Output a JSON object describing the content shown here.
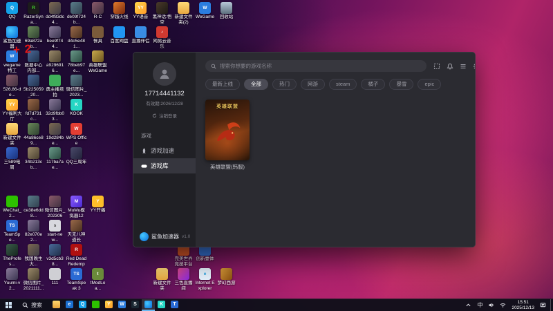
{
  "desktop": {
    "annotation": "+ 2",
    "icons": [
      {
        "label": "QQ",
        "col": 1,
        "row": 1,
        "bg": "#14a0e8",
        "glyph": "Q"
      },
      {
        "label": "RazerSyna...",
        "col": 2,
        "row": 1,
        "bg": "#1c1c1c",
        "fg": "#44d62c",
        "glyph": "R"
      },
      {
        "label": "dd4f83dc4...",
        "col": 3,
        "row": 1,
        "bg": "linear-gradient(135deg,#7d6a52,#3e3a45)"
      },
      {
        "label": "de09f724b...",
        "col": 4,
        "row": 1,
        "bg": "linear-gradient(135deg,#5a7d8a,#31404f)"
      },
      {
        "label": "R-C",
        "col": 5,
        "row": 1,
        "bg": "linear-gradient(135deg,#8a5a6a,#403040)"
      },
      {
        "label": "穿越火线",
        "col": 6,
        "row": 1,
        "bg": "linear-gradient(135deg,#e07a2a,#7a2a10)"
      },
      {
        "label": "YY语音",
        "col": 7,
        "row": 1,
        "bg": "linear-gradient(135deg,#ffd84a,#ff9a2a)",
        "glyph": "YY"
      },
      {
        "label": "黑神话:悟空",
        "col": 8,
        "row": 1,
        "bg": "linear-gradient(135deg,#4a3a2a,#1c1814)"
      },
      {
        "label": "新建文件夹(2)",
        "col": 9,
        "row": 1,
        "bg": "linear-gradient(180deg,#ffd976,#e8a841)"
      },
      {
        "label": "WeGame",
        "col": 10,
        "row": 1,
        "bg": "#2b7de0",
        "glyph": "W"
      },
      {
        "label": "回收站",
        "col": 11,
        "row": 1,
        "bg": "linear-gradient(180deg,#b8c8d8,#5d707e)"
      },
      {
        "label": "鲨鱼加速器",
        "col": 1,
        "row": 2,
        "bg": "radial-gradient(circle at 35% 35%,#45c8ff,#0a6bd8)"
      },
      {
        "label": "69a872ab...",
        "col": 2,
        "row": 2,
        "bg": "linear-gradient(135deg,#6a8a5a,#2f4030)"
      },
      {
        "label": "bee9f744...",
        "col": 3,
        "row": 2,
        "bg": "linear-gradient(135deg,#8a7a9a,#3a3550)"
      },
      {
        "label": "d4c5e481...",
        "col": 4,
        "row": 2,
        "bg": "linear-gradient(135deg,#9a6a4a,#4a3020)"
      },
      {
        "label": "餐具",
        "col": 5,
        "row": 2,
        "bg": "#7a5a3a"
      },
      {
        "label": "百度网盘",
        "col": 6,
        "row": 2,
        "bg": "#2196f3"
      },
      {
        "label": "直播伴侣",
        "col": 7,
        "row": 2,
        "bg": "#3a8ee6"
      },
      {
        "label": "网易云音乐",
        "col": 8,
        "row": 2,
        "bg": "#d33a31",
        "glyph": "♪"
      },
      {
        "label": "wegame特工",
        "col": 1,
        "row": 3,
        "bg": "#2b7de0",
        "glyph": "W"
      },
      {
        "label": "数据中心内部...",
        "col": 2,
        "row": 3,
        "bg": "linear-gradient(135deg,#4a6a9a,#20304a)"
      },
      {
        "label": "a9296916...",
        "col": 3,
        "row": 3,
        "bg": "linear-gradient(135deg,#9a8a6a,#4a4030)"
      },
      {
        "label": "78beb97e...",
        "col": 4,
        "row": 3,
        "bg": "linear-gradient(135deg,#6a9a8a,#2a4a40)"
      },
      {
        "label": "英雄联盟WeGame",
        "col": 5,
        "row": 3,
        "bg": "linear-gradient(135deg,#c8a84b,#6b5420)"
      },
      {
        "label": "526.86-de...",
        "col": 1,
        "row": 4,
        "bg": "linear-gradient(135deg,#8a5a6a,#403040)"
      },
      {
        "label": "5b225059_20...",
        "col": 2,
        "row": 4,
        "bg": "linear-gradient(135deg,#4a6a9a,#20304a)"
      },
      {
        "label": "典主播竞拍",
        "col": 3,
        "row": 4,
        "bg": "#3fae5a"
      },
      {
        "label": "微信图片_2023...",
        "col": 4,
        "row": 4,
        "bg": "linear-gradient(135deg,#5a7d8a,#31404f)"
      },
      {
        "label": "YY福利大厅",
        "col": 1,
        "row": 5,
        "bg": "linear-gradient(135deg,#ffd84a,#ff9a2a)",
        "glyph": "YY"
      },
      {
        "label": "fd7d731c...",
        "col": 2,
        "row": 5,
        "bg": "linear-gradient(135deg,#9a6a4a,#4a3020)"
      },
      {
        "label": "32d9fbb03...",
        "col": 3,
        "row": 5,
        "bg": "linear-gradient(135deg,#8a7a9a,#3a3550)"
      },
      {
        "label": "KOOK",
        "col": 4,
        "row": 5,
        "bg": "#26d6c4",
        "glyph": "K"
      },
      {
        "label": "新建文件夹",
        "col": 1,
        "row": 6,
        "bg": "linear-gradient(180deg,#ffd976,#e8a841)"
      },
      {
        "label": "44a86ce89...",
        "col": 2,
        "row": 6,
        "bg": "linear-gradient(135deg,#6a8a5a,#2f4030)"
      },
      {
        "label": "19d284be...",
        "col": 3,
        "row": 6,
        "bg": "linear-gradient(135deg,#7d6a52,#3e3a45)"
      },
      {
        "label": "WPS Office",
        "col": 4,
        "row": 6,
        "bg": "#e33e33",
        "glyph": "W"
      },
      {
        "label": "三589电周",
        "col": 1,
        "row": 7,
        "bg": "linear-gradient(135deg,#3a6ad0,#18307a)"
      },
      {
        "label": "34b213cb...",
        "col": 2,
        "row": 7,
        "bg": "linear-gradient(135deg,#9a8a6a,#4a4030)"
      },
      {
        "label": "117ba7ae...",
        "col": 3,
        "row": 7,
        "bg": "linear-gradient(135deg,#6a9a8a,#2a4a40)"
      },
      {
        "label": "QQ三周年",
        "col": 4,
        "row": 7,
        "bg": "linear-gradient(135deg,#4a4a6a,#22223a)"
      },
      {
        "label": "WeChat_2...",
        "col": 1,
        "row": 9,
        "bg": "#2dc100"
      },
      {
        "label": "ce38e6dd8...",
        "col": 2,
        "row": 9,
        "bg": "linear-gradient(135deg,#5a7d8a,#31404f)"
      },
      {
        "label": "微信图片_2023060...",
        "col": 3,
        "row": 9,
        "bg": "linear-gradient(135deg,#8a5a6a,#403040)"
      },
      {
        "label": "MuMu模拟器12",
        "col": 4,
        "row": 9,
        "bg": "linear-gradient(135deg,#8a5aff,#4a2ad0)",
        "glyph": "M"
      },
      {
        "label": "YY开播",
        "col": 5,
        "row": 9,
        "bg": "#ffbf2a",
        "glyph": "Y"
      },
      {
        "label": "TeamSpe...",
        "col": 1,
        "row": 10,
        "bg": "#2a6ad4",
        "glyph": "TS"
      },
      {
        "label": "82e070e2...",
        "col": 2,
        "row": 10,
        "bg": "linear-gradient(135deg,#8a7a9a,#3a3550)"
      },
      {
        "label": "start-new...",
        "col": 3,
        "row": 10,
        "bg": "#d8d8de",
        "fg": "#444",
        "glyph": "s"
      },
      {
        "label": "天无八神道长",
        "col": 4,
        "row": 10,
        "bg": "linear-gradient(135deg,#9a6a4a,#4a3020)"
      },
      {
        "label": "TheProfes...",
        "col": 1,
        "row": 11,
        "bg": "linear-gradient(135deg,#3a5a4a,#16281e)"
      },
      {
        "label": "我国晚生大...",
        "col": 2,
        "row": 11,
        "bg": "linear-gradient(135deg,#7d6a52,#3e3a45)"
      },
      {
        "label": "v3d5cb38...",
        "col": 3,
        "row": 11,
        "bg": "linear-gradient(135deg,#4a6a9a,#20304a)"
      },
      {
        "label": "Red Dead Redempt...",
        "col": 4,
        "row": 11,
        "bg": "#b01010",
        "glyph": "R"
      },
      {
        "label": "完美世界竞技平台",
        "col": 9,
        "row": 11,
        "bg": "#e05a2a"
      },
      {
        "label": "创新壹体",
        "col": 10,
        "row": 11,
        "bg": "#3a7ae0"
      },
      {
        "label": "Yuumi-v2...",
        "col": 1,
        "row": 12,
        "bg": "linear-gradient(135deg,#8a7a9a,#3a3550)"
      },
      {
        "label": "微信图片_2021111...",
        "col": 2,
        "row": 12,
        "bg": "linear-gradient(135deg,#9a8a6a,#4a4030)"
      },
      {
        "label": "111",
        "col": 3,
        "row": 12,
        "bg": "#cfcfd4",
        "fg": "#333"
      },
      {
        "label": "TeamSpeak 3",
        "col": 4,
        "row": 12,
        "bg": "#2a6ad4",
        "glyph": "TS"
      },
      {
        "label": "tModLoa...",
        "col": 5,
        "row": 12,
        "bg": "#6a8a3a",
        "glyph": "t"
      },
      {
        "label": "新建文件夹",
        "col": 8,
        "row": 12,
        "bg": "linear-gradient(180deg,#ffd976,#e8a841)"
      },
      {
        "label": "三色直播间",
        "col": 9,
        "row": 12,
        "bg": "linear-gradient(135deg,#e04a8a,#8a2ae0)"
      },
      {
        "label": "Internet Explorer",
        "col": 10,
        "row": 12,
        "bg": "#e8f4ff",
        "fg": "#1b9de0",
        "glyph": "e"
      },
      {
        "label": "梦幻西游",
        "col": 11,
        "row": 12,
        "bg": "linear-gradient(135deg,#e0a03a,#8a5010)"
      }
    ]
  },
  "window": {
    "sidebar": {
      "phone": "17714441132",
      "expiry": "有效期:2026/12/28",
      "logout_label": "注销登录",
      "section_label": "游戏",
      "boost_label": "游戏加速",
      "library_label": "游戏库",
      "brand": "鲨鱼加速器",
      "version": "v1.0"
    },
    "header": {
      "search_placeholder": "搜索你想要的游戏名称",
      "icons": [
        "capture-icon",
        "notification-icon",
        "menu-icon",
        "settings-icon"
      ]
    },
    "filters": [
      {
        "label": "最新上线",
        "active": false
      },
      {
        "label": "全部",
        "active": true
      },
      {
        "label": "热门",
        "active": false
      },
      {
        "label": "网游",
        "active": false
      },
      {
        "label": "steam",
        "active": false
      },
      {
        "label": "橘子",
        "active": false
      },
      {
        "label": "暴雪",
        "active": false
      },
      {
        "label": "epic",
        "active": false
      }
    ],
    "games": [
      {
        "title": "英雄联盟(韩服)",
        "cover_title": "英雄联盟"
      }
    ]
  },
  "taskbar": {
    "search_label": "搜索",
    "apps": [
      {
        "name": "file-explorer",
        "bg": "linear-gradient(180deg,#ffd76e,#e8a33d)",
        "glyph": "",
        "active": false
      },
      {
        "name": "browser",
        "bg": "#1b6fd0",
        "glyph": "e",
        "active": false
      },
      {
        "name": "qq",
        "bg": "#14a0e8",
        "glyph": "Q",
        "active": false
      },
      {
        "name": "wechat",
        "bg": "#2dc100",
        "glyph": "",
        "active": false
      },
      {
        "name": "yy",
        "bg": "linear-gradient(135deg,#ffd84a,#ff9a2a)",
        "glyph": "Y",
        "active": false
      },
      {
        "name": "wegame",
        "bg": "#2b7de0",
        "glyph": "W",
        "active": false
      },
      {
        "name": "steam",
        "bg": "#1a2732",
        "glyph": "S",
        "active": false
      },
      {
        "name": "shark-accelerator",
        "bg": "radial-gradient(circle at 35% 35%,#45c8ff,#0a6bd8)",
        "glyph": "",
        "active": true
      },
      {
        "name": "kook",
        "bg": "#26d6c4",
        "glyph": "K",
        "active": false
      },
      {
        "name": "teamspeak",
        "bg": "#2a6ad4",
        "glyph": "T",
        "active": false
      }
    ],
    "tray": {
      "ime": "中",
      "time": "15:51",
      "date": "2025/12/13"
    }
  }
}
